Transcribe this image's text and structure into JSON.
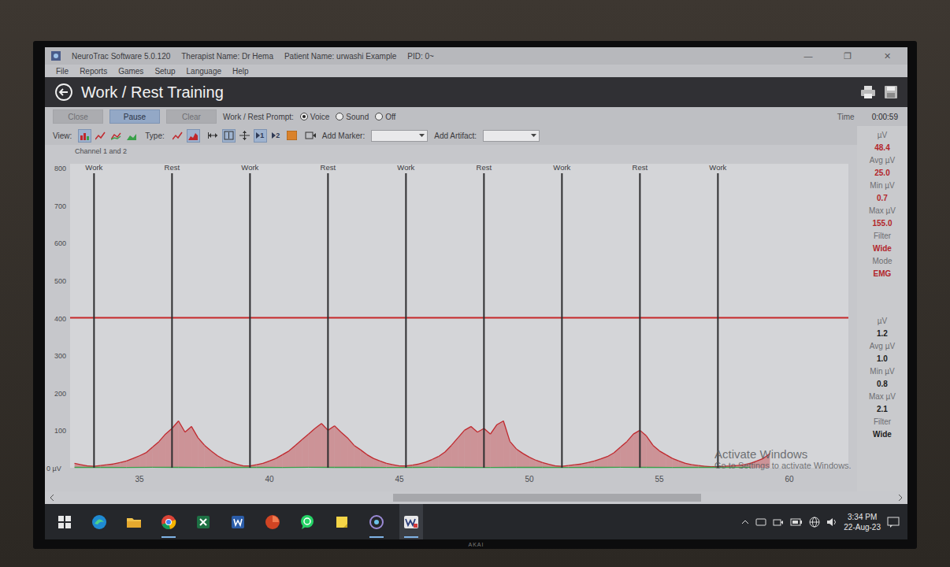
{
  "window": {
    "title": "NeuroTrac Software 5.0.120",
    "therapist": "Therapist Name: Dr Hema",
    "patient": "Patient Name: urwashi  Example",
    "pid": "PID: 0~",
    "controls": [
      "—",
      "❐",
      "✕"
    ]
  },
  "menu": [
    "File",
    "Reports",
    "Games",
    "Setup",
    "Language",
    "Help"
  ],
  "header": {
    "title": "Work / Rest Training"
  },
  "controls": {
    "buttons": [
      {
        "label": "Close",
        "selected": false
      },
      {
        "label": "Pause",
        "selected": true
      },
      {
        "label": "Clear",
        "selected": false
      }
    ],
    "prompt_label": "Work / Rest Prompt:",
    "prompt_options": [
      {
        "label": "Voice",
        "selected": true
      },
      {
        "label": "Sound",
        "selected": false
      },
      {
        "label": "Off",
        "selected": false
      }
    ],
    "time_label": "Time",
    "time": "0:00:59"
  },
  "view_toolbar": {
    "view_label": "View:",
    "view_modes": [
      {
        "kind": "bars",
        "selected": true
      },
      {
        "kind": "line",
        "selected": false
      },
      {
        "kind": "overlay",
        "selected": false
      },
      {
        "kind": "split",
        "selected": false
      }
    ],
    "type_label": "Type:",
    "types": [
      {
        "kind": "line",
        "selected": false
      },
      {
        "kind": "area",
        "selected": true
      }
    ],
    "tools": [
      {
        "kind": "fit-width",
        "label": "",
        "selected": false
      },
      {
        "kind": "fit-height",
        "label": "",
        "selected": true
      },
      {
        "kind": "move",
        "label": "",
        "selected": false
      },
      {
        "kind": "channel",
        "label": "1",
        "selected": true
      },
      {
        "kind": "channel",
        "label": "2",
        "selected": false
      },
      {
        "kind": "color",
        "label": "",
        "selected": false
      }
    ],
    "marker_label": "Add Marker:",
    "marker_value": "",
    "artifact_label": "Add Artifact:",
    "artifact_value": ""
  },
  "chart": {
    "title": "Channel 1 and 2",
    "y_ticks": [
      "800",
      "700",
      "600",
      "500",
      "400",
      "300",
      "200",
      "100",
      "0 µV"
    ],
    "x_ticks": [
      "35",
      "40",
      "45",
      "50",
      "55",
      "60"
    ],
    "threshold": 400,
    "markers": [
      {
        "label": "Work",
        "time": 33.25
      },
      {
        "label": "Rest",
        "time": 36.25
      },
      {
        "label": "Work",
        "time": 39.25
      },
      {
        "label": "Rest",
        "time": 42.25
      },
      {
        "label": "Work",
        "time": 45.25
      },
      {
        "label": "Rest",
        "time": 48.25
      },
      {
        "label": "Work",
        "time": 51.25
      },
      {
        "label": "Rest",
        "time": 54.25
      },
      {
        "label": "Work",
        "time": 57.25
      }
    ],
    "series": [
      {
        "name": "Channel 1",
        "kind": "area",
        "color": "#c0282d",
        "sample_start_s": 32.5,
        "sample_interval_s": 0.25,
        "values": [
          12,
          8,
          5,
          4,
          6,
          8,
          10,
          14,
          18,
          25,
          32,
          40,
          55,
          70,
          90,
          105,
          125,
          95,
          110,
          80,
          60,
          45,
          32,
          22,
          15,
          9,
          5,
          5,
          8,
          12,
          18,
          25,
          35,
          45,
          60,
          75,
          90,
          105,
          118,
          100,
          112,
          95,
          80,
          60,
          48,
          35,
          25,
          18,
          12,
          8,
          5,
          5,
          7,
          10,
          15,
          22,
          30,
          42,
          60,
          80,
          100,
          110,
          95,
          105,
          90,
          115,
          125,
          70,
          50,
          38,
          28,
          20,
          14,
          9,
          5,
          4,
          6,
          8,
          10,
          14,
          18,
          24,
          30,
          40,
          55,
          70,
          90,
          100,
          85,
          60,
          45,
          35,
          25,
          18,
          12,
          8,
          6,
          4,
          3,
          3,
          4,
          5,
          6,
          8,
          12,
          18,
          25,
          38
        ]
      },
      {
        "name": "Channel 2",
        "kind": "line",
        "color": "#3aa04a",
        "sample_start_s": 32.5,
        "sample_interval_s": 1.0,
        "values": [
          1.0,
          1.1,
          0.9,
          1.2,
          1.0,
          0.8,
          1.1,
          1.0,
          0.9,
          1.2,
          1.1,
          1.0,
          0.9,
          1.0,
          1.2,
          1.1,
          0.8,
          1.0,
          1.1,
          0.9,
          1.0,
          1.2,
          1.0,
          0.9,
          1.1,
          1.0,
          1.2
        ]
      }
    ],
    "scrollbar": {
      "offset": 0.4,
      "level": 0.37
    }
  },
  "stats": [
    {
      "channel": "1",
      "color": "#b3262b",
      "rows": [
        {
          "label": "µV",
          "value": "48.4"
        },
        {
          "label": "Avg µV",
          "value": "25.0"
        },
        {
          "label": "Min µV",
          "value": "0.7"
        },
        {
          "label": "Max µV",
          "value": "155.0"
        },
        {
          "label": "Filter",
          "value": "Wide"
        },
        {
          "label": "Mode",
          "value": "EMG"
        }
      ]
    },
    {
      "channel": "2",
      "color": "#1c1c1c",
      "rows": [
        {
          "label": "µV",
          "value": "1.2"
        },
        {
          "label": "Avg µV",
          "value": "1.0"
        },
        {
          "label": "Min µV",
          "value": "0.8"
        },
        {
          "label": "Max µV",
          "value": "2.1"
        },
        {
          "label": "Filter",
          "value": "Wide"
        }
      ]
    }
  ],
  "watermark": {
    "title": "Activate Windows",
    "subtitle": "Go to Settings to activate Windows."
  },
  "taskbar": {
    "apps": [
      {
        "kind": "edge",
        "running": false
      },
      {
        "kind": "explorer",
        "running": false
      },
      {
        "kind": "chrome",
        "running": true
      },
      {
        "kind": "excel",
        "running": false
      },
      {
        "kind": "word",
        "running": false
      },
      {
        "kind": "powerpoint",
        "running": false
      },
      {
        "kind": "whatsapp",
        "running": false
      },
      {
        "kind": "sticky-notes",
        "running": false
      },
      {
        "kind": "neurotrac",
        "running": true
      },
      {
        "kind": "ws-app",
        "running": true
      }
    ],
    "time": "3:34 PM",
    "date": "22-Aug-23"
  },
  "bezel": {
    "brand": "AKAI"
  }
}
